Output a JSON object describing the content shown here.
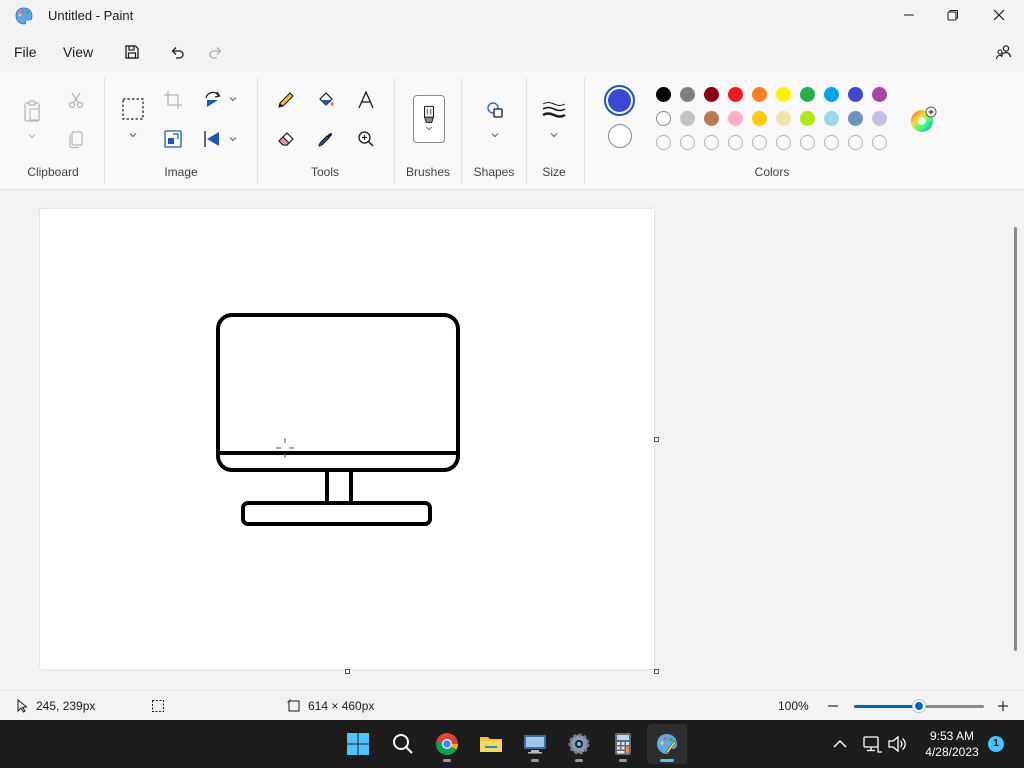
{
  "window": {
    "title": "Untitled - Paint",
    "app_icon": "paint-palette-icon",
    "controls": [
      "minimize-icon",
      "restore-icon",
      "close-icon"
    ]
  },
  "menu": {
    "file": "File",
    "view": "View",
    "quick_access": [
      "save-icon",
      "undo-icon",
      "redo-icon"
    ],
    "share_icon": "people-share-icon"
  },
  "ribbon": {
    "groups": {
      "clipboard": "Clipboard",
      "image": "Image",
      "tools": "Tools",
      "brushes": "Brushes",
      "shapes": "Shapes",
      "size": "Size",
      "colors": "Colors"
    },
    "tools": {
      "clipboard": [
        "paste-icon",
        "cut-icon",
        "copy-icon"
      ],
      "image": [
        "select-rectangle-icon",
        "crop-icon",
        "resize-icon",
        "rotate-icon",
        "flip-icon"
      ],
      "tools": [
        "pencil-icon",
        "fill-bucket-icon",
        "text-icon",
        "eraser-icon",
        "color-picker-icon",
        "magnifier-icon"
      ],
      "brushes": "brush-icon",
      "shapes": "shapes-icon",
      "size": "line-size-icon"
    },
    "primary_color": "#3c47d6",
    "secondary_color": "#ffffff",
    "palette_rows": [
      [
        "#000000",
        "#7f7f7f",
        "#880015",
        "#ed1c24",
        "#ff7f27",
        "#fff200",
        "#22b14c",
        "#00a2e8",
        "#3f48cc",
        "#a349a4"
      ],
      [
        "#ffffff",
        "#c3c3c3",
        "#b97a57",
        "#ffaec9",
        "#ffc90e",
        "#efe4b0",
        "#b5e61d",
        "#99d9ea",
        "#7092be",
        "#c8bfe7"
      ],
      [
        "",
        "",
        "",
        "",
        "",
        "",
        "",
        "",
        "",
        ""
      ]
    ],
    "edit_colors_icon": "color-wheel-icon"
  },
  "canvas": {
    "drawing": "monitor-drawing"
  },
  "status": {
    "cursor_position": "245, 239px",
    "selection_size": "",
    "canvas_size": "614 × 460px",
    "zoom": "100%",
    "zoom_level": 0.5
  },
  "taskbar": {
    "apps": [
      "windows-start-icon",
      "search-icon",
      "chrome-icon",
      "file-explorer-icon",
      "remote-desktop-icon",
      "settings-icon",
      "calculator-icon",
      "paint-icon"
    ],
    "active_app": "paint-icon",
    "time": "9:53 AM",
    "date": "4/28/2023",
    "notifications": "1"
  }
}
